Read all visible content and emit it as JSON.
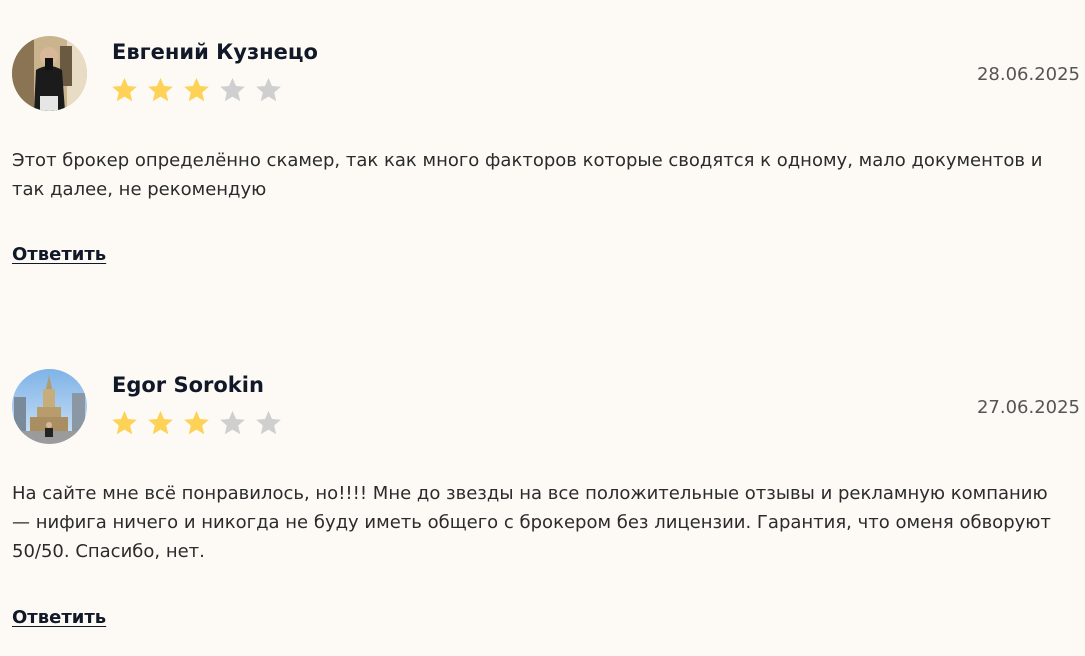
{
  "reviews": [
    {
      "author": "Евгений Кузнецо",
      "avatar": "avatar-photo",
      "rating": 3,
      "max_rating": 5,
      "date": "28.06.2025",
      "text": "Этот брокер определённо скамер, так как много факторов которые сводятся к одному, мало документов и так далее, не рекомендую",
      "reply_label": "Ответить"
    },
    {
      "author": "Egor Sorokin",
      "avatar": "avatar-photo",
      "rating": 3,
      "max_rating": 5,
      "date": "27.06.2025",
      "text": "На сайте мне всё понравилось, но!!!! Мне до звезды на все положительные отзывы и рекламную компанию — нифига ничего и никогда не буду иметь общего с брокером без лицензии. Гарантия, что оменя обворуют 50/50. Спасибо, нет.",
      "reply_label": "Ответить"
    }
  ],
  "colors": {
    "star_filled": "#fdd257",
    "star_empty": "#cfcfcf",
    "text": "#2b2b2b",
    "background": "#fdfaf6"
  }
}
